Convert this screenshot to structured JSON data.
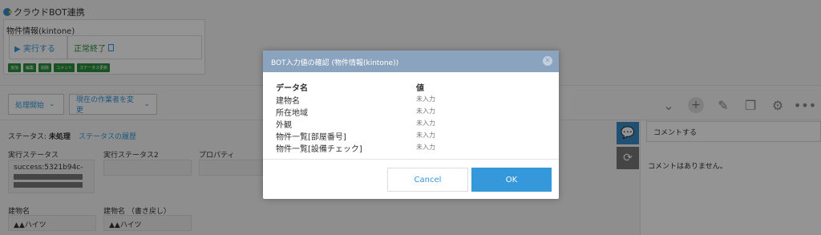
{
  "app": {
    "title": "クラウドBOT連携",
    "plugin_title": "物件情報(kintone)",
    "run_label": "▶ 実行する",
    "result_label": "正常終了",
    "mini_buttons": [
      "追加",
      "編集",
      "削除",
      "コメント",
      "ステータス更新"
    ],
    "process_button": "処理開始",
    "assignee_button": "現在の作業者を変更",
    "status_label": "ステータス:",
    "status_value": "未処理",
    "status_history": "ステータスの履歴",
    "fields": {
      "exec_status_label": "実行ステータス",
      "exec_status_value": "success:5321b94c-",
      "exec_status2_label": "実行ステータス2",
      "property_label": "プロパティ",
      "building_label": "建物名",
      "building_value": "▲▲ハイツ",
      "building_rewrite_label": "建物名 （書き戻し）",
      "building_rewrite_value": "▲▲ハイツ"
    },
    "comment_placeholder": "コメントする",
    "no_comments": "コメントはありません。"
  },
  "modal": {
    "title": "BOT入力値の確認 (物件情報(kintone))",
    "col_name": "データ名",
    "col_value": "値",
    "rows": [
      {
        "name": "建物名",
        "value": "未入力"
      },
      {
        "name": "所在地域",
        "value": "未入力"
      },
      {
        "name": "外観",
        "value": "未入力"
      },
      {
        "name": "物件一覧[部屋番号]",
        "value": "未入力"
      },
      {
        "name": "物件一覧[設備チェック]",
        "value": "未入力"
      }
    ],
    "cancel_label": "Cancel",
    "ok_label": "OK"
  },
  "colors": {
    "header": "#8aa3bf",
    "primary": "#3498db",
    "success": "#2a8a3e"
  }
}
